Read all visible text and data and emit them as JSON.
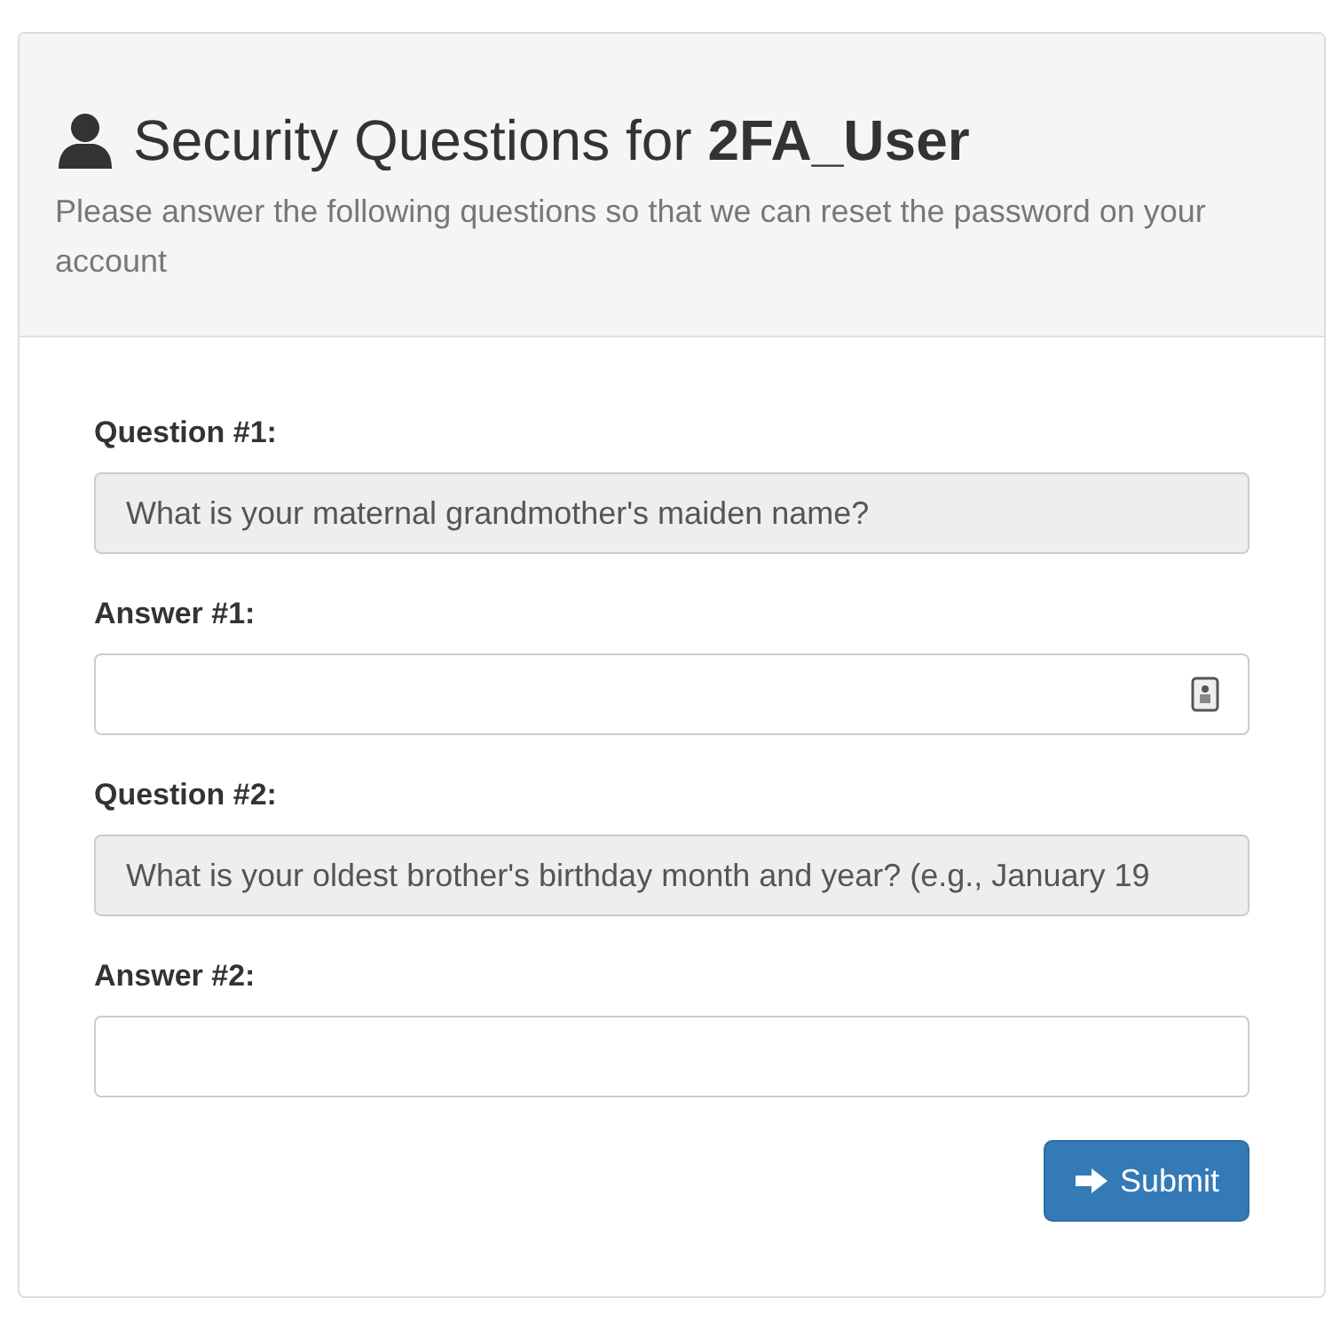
{
  "header": {
    "title": "Security Questions for **2FA_User**",
    "subtitle": "Please answer the following questions so that we can reset the password on your account"
  },
  "fields": [
    {
      "label": "Question #1:",
      "kind": "question",
      "value": "What is your maternal grandmother's maiden name?"
    },
    {
      "label": "Answer #1:",
      "kind": "answer",
      "autofill_icon": true
    },
    {
      "label": "Question #2:",
      "kind": "question",
      "value": "What is your oldest brother's birthday month and year? (e.g., January 19"
    },
    {
      "label": "Answer #2:",
      "kind": "answer",
      "autofill_icon": false
    }
  ],
  "submit_button": {
    "label": "Submit"
  }
}
